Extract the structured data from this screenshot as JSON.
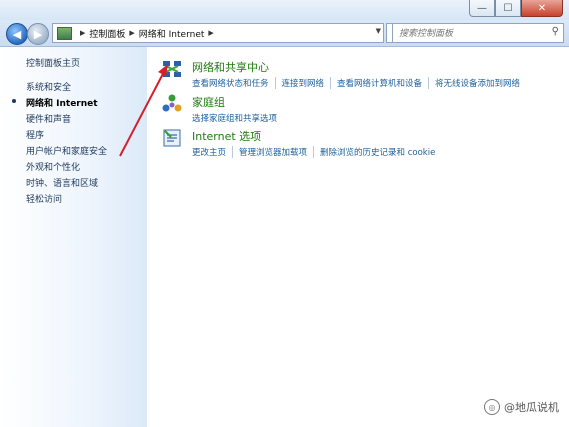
{
  "window": {
    "minimize_label": "—",
    "maximize_label": "☐",
    "close_label": "✕"
  },
  "navbar": {
    "breadcrumb": [
      "控制面板",
      "网络和 Internet"
    ],
    "search_placeholder": "搜索控制面板"
  },
  "sidebar": {
    "items": [
      "控制面板主页",
      "系统和安全",
      "网络和 Internet",
      "硬件和声音",
      "程序",
      "用户帐户和家庭安全",
      "外观和个性化",
      "时钟、语言和区域",
      "轻松访问"
    ],
    "current_index": 2
  },
  "categories": [
    {
      "title": "网络和共享中心",
      "icon": "network-sharing-center-icon",
      "links": [
        "查看网络状态和任务",
        "连接到网络",
        "查看网络计算机和设备",
        "将无线设备添加到网络"
      ]
    },
    {
      "title": "家庭组",
      "icon": "homegroup-icon",
      "links": [
        "选择家庭组和共享选项"
      ]
    },
    {
      "title": "Internet 选项",
      "icon": "internet-options-icon",
      "links": [
        "更改主页",
        "管理浏览器加载项",
        "删除浏览的历史记录和 cookie"
      ]
    }
  ],
  "annotation": {
    "arrow_color": "#d4202a"
  },
  "watermark": {
    "text": "@地瓜说机"
  }
}
